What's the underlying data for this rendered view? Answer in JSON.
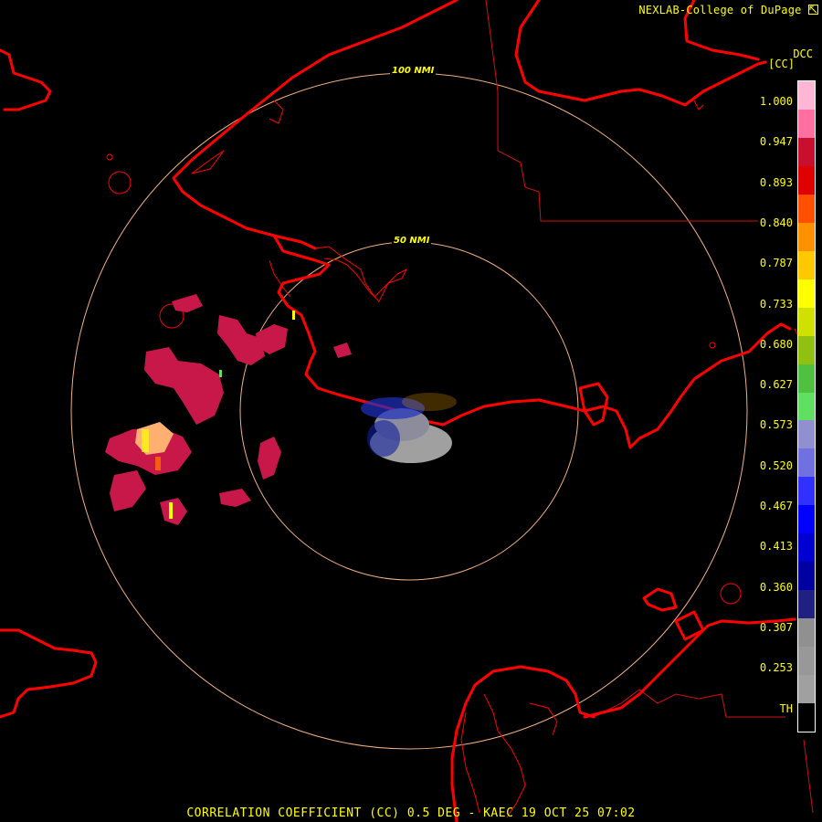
{
  "header": {
    "credit": "NEXLAB-College of DuPage",
    "credit_icon": "arrow-icon"
  },
  "legend": {
    "product_code": "DCC",
    "unit": "[CC]",
    "ticks": [
      "1.000",
      "0.947",
      "0.893",
      "0.840",
      "0.787",
      "0.733",
      "0.680",
      "0.627",
      "0.573",
      "0.520",
      "0.467",
      "0.413",
      "0.360",
      "0.307",
      "0.253",
      "TH"
    ],
    "colors": [
      "#ffb6d5",
      "#ff70a0",
      "#c8102e",
      "#e00000",
      "#ff5000",
      "#ff9000",
      "#ffc800",
      "#ffff00",
      "#d0e000",
      "#90c010",
      "#50c040",
      "#60e060",
      "#9090d0",
      "#7070e0",
      "#3030ff",
      "#0000ff",
      "#0000d0",
      "#0000a0",
      "#202080",
      "#909090",
      "#989898",
      "#a0a0a0",
      "#000000"
    ]
  },
  "rings": {
    "inner_label": "50 NMI",
    "outer_label": "100 NMI"
  },
  "footer": {
    "caption": "CORRELATION COEFFICIENT (CC) 0.5 DEG - KAEC 19 OCT 25 07:02"
  },
  "colors": {
    "coastline": "#ff0000",
    "ring": "#f0b080",
    "text": "#ffff00"
  }
}
